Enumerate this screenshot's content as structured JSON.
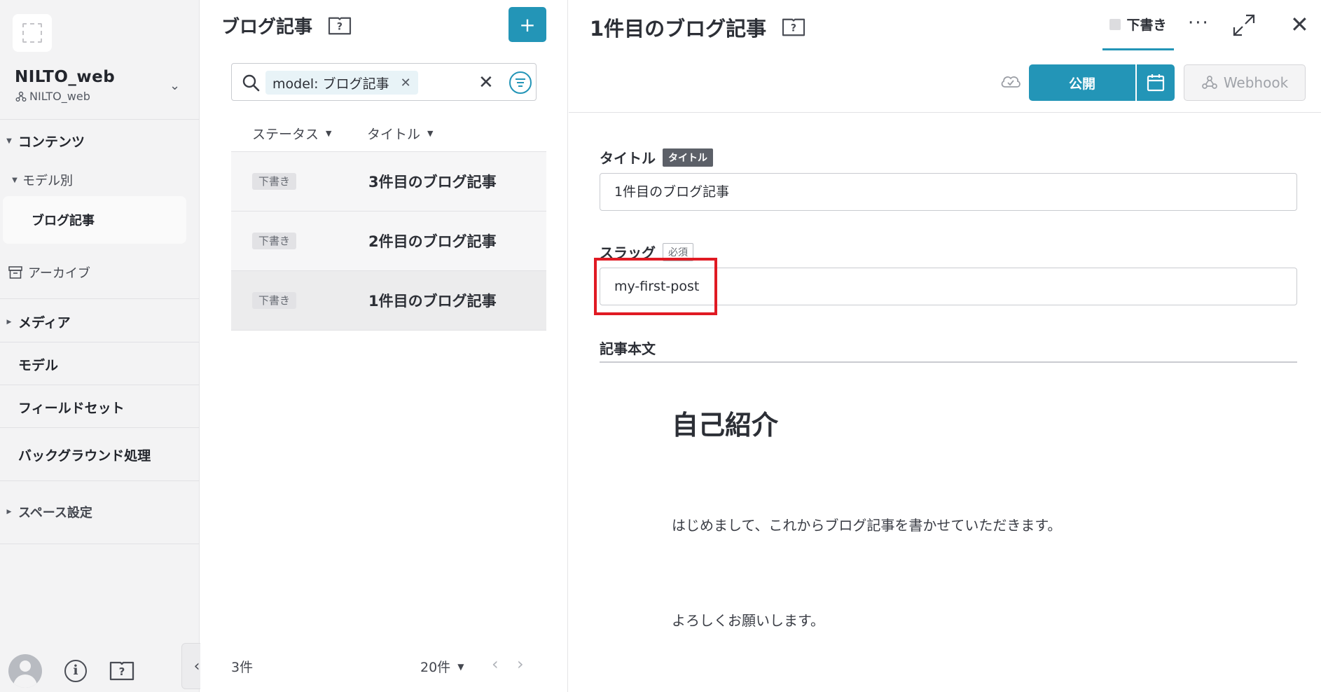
{
  "sidebar": {
    "space_name": "NILTO_web",
    "space_sub": "NILTO_web",
    "content_label": "コンテンツ",
    "by_model_label": "モデル別",
    "active_model": "ブログ記事",
    "archive_label": "アーカイブ",
    "media_label": "メディア",
    "model_label": "モデル",
    "fieldset_label": "フィールドセット",
    "background_label": "バックグラウンド処理",
    "space_settings_label": "スペース設定"
  },
  "list": {
    "title": "ブログ記事",
    "add_label": "+",
    "search_chip": "model: ブログ記事",
    "col_status": "ステータス",
    "col_title": "タイトル",
    "rows": [
      {
        "status": "下書き",
        "title": "3件目のブログ記事"
      },
      {
        "status": "下書き",
        "title": "2件目のブログ記事"
      },
      {
        "status": "下書き",
        "title": "1件目のブログ記事"
      }
    ],
    "count": "3件",
    "per_page": "20件"
  },
  "detail": {
    "title": "1件目のブログ記事",
    "status_tab": "下書き",
    "publish_label": "公開",
    "webhook_label": "Webhook",
    "title_field_label": "タイトル",
    "title_field_tag": "タイトル",
    "title_value": "1件目のブログ記事",
    "slug_label": "スラッグ",
    "slug_tag": "必須",
    "slug_value": "my-first-post",
    "body_label": "記事本文",
    "body_heading": "自己紹介",
    "body_p1": "はじめまして、これからブログ記事を書かせていただきます。",
    "body_p2": "よろしくお願いします。"
  },
  "colors": {
    "accent": "#2395b7",
    "highlight": "#e01a23"
  }
}
